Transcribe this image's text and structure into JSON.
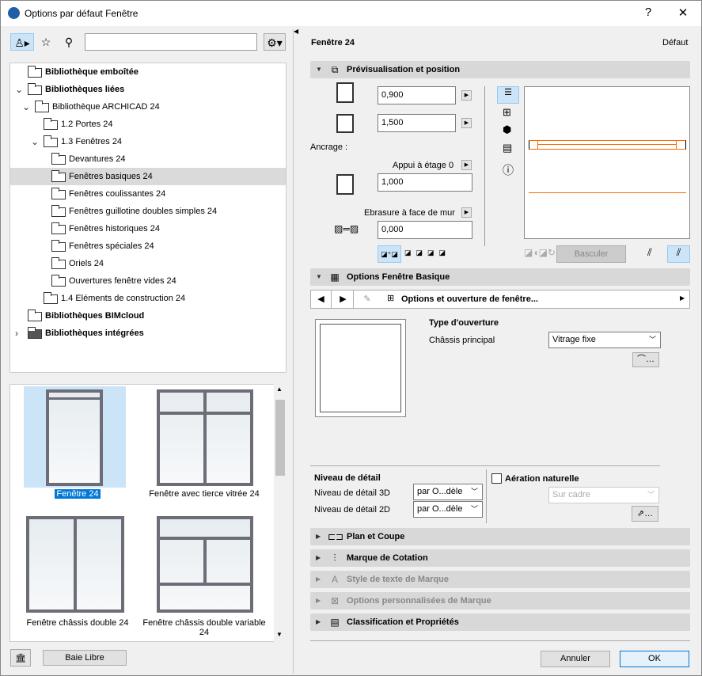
{
  "window": {
    "title": "Options par défaut Fenêtre",
    "help": "?",
    "close": "✕"
  },
  "left": {
    "tree": [
      {
        "label": "Bibliothèque emboîtée",
        "bold": true
      },
      {
        "label": "Bibliothèques liées",
        "bold": true
      },
      {
        "label": "Bibliothèque ARCHICAD 24"
      },
      {
        "label": "1.2 Portes 24"
      },
      {
        "label": "1.3 Fenêtres 24"
      },
      {
        "label": "Devantures 24"
      },
      {
        "label": "Fenêtres basiques 24"
      },
      {
        "label": "Fenêtres coulissantes 24"
      },
      {
        "label": "Fenêtres guillotine doubles simples 24"
      },
      {
        "label": "Fenêtres historiques 24"
      },
      {
        "label": "Fenêtres spéciales 24"
      },
      {
        "label": "Oriels 24"
      },
      {
        "label": "Ouvertures fenêtre vides 24"
      },
      {
        "label": "1.4 Eléments de construction 24"
      },
      {
        "label": "Bibliothèques BIMcloud",
        "bold": true
      },
      {
        "label": "Bibliothèques intégrées",
        "bold": true
      }
    ],
    "gallery": [
      "Fenêtre 24",
      "Fenêtre avec tierce vitrée 24",
      "Fenêtre châssis double 24",
      "Fenêtre châssis double variable 24"
    ],
    "baie_libre": "Baie Libre"
  },
  "right": {
    "object_name": "Fenêtre 24",
    "default_label": "Défaut",
    "sections": {
      "preview": "Prévisualisation et position",
      "basic": "Options Fenêtre Basique",
      "plan": "Plan et Coupe",
      "dim": "Marque de Cotation",
      "textstyle": "Style de texte de Marque",
      "custom": "Options personnalisées de Marque",
      "class": "Classification et Propriétés"
    },
    "width": "0,900",
    "height": "1,500",
    "anchor_label": "Ancrage :",
    "sill_label": "Appui à étage 0",
    "sill": "1,000",
    "reveal_label": "Ebrasure à face de mur",
    "reveal": "0,000",
    "flip": "Basculer",
    "page_nav": "Options et ouverture de fenêtre...",
    "opening_type": "Type d'ouverture",
    "main_sash": "Châssis principal",
    "main_sash_value": "Vitrage fixe",
    "detail_title": "Niveau de détail",
    "detail3d": "Niveau de détail 3D",
    "detail3d_value": "par O...dèle",
    "detail2d": "Niveau de détail 2D",
    "detail2d_value": "par O...dèle",
    "ventilation": "Aération naturelle",
    "vent_value": "Sur cadre",
    "cancel": "Annuler",
    "ok": "OK"
  },
  "colors": {
    "accent": "#ff6a00",
    "selection": "#cce4f7"
  }
}
